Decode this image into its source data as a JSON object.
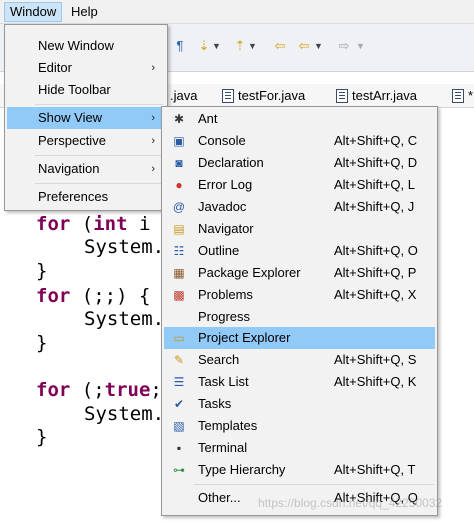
{
  "menubar": {
    "items": [
      {
        "label": "Window"
      },
      {
        "label": "Help"
      }
    ]
  },
  "tabs": [
    {
      "label": ".java"
    },
    {
      "label": "testFor.java"
    },
    {
      "label": "testArr.java"
    },
    {
      "label": "*"
    }
  ],
  "code": {
    "lines": [
      {
        "kw": "for",
        "rest": " (",
        "kw2": "int",
        "rest2": " i"
      },
      {
        "text": "System."
      },
      {
        "text": "}"
      },
      {
        "kw": "for",
        "rest": " (;;) {"
      },
      {
        "text": "System."
      },
      {
        "text": "}"
      },
      {
        "kw": "for",
        "rest": " (;",
        "kw2": "true",
        "rest2": ";"
      },
      {
        "text": "System."
      },
      {
        "text": "}"
      }
    ]
  },
  "window_menu": {
    "items": [
      {
        "label": "New Window"
      },
      {
        "label": "Editor"
      },
      {
        "label": "Hide Toolbar"
      },
      {
        "label": "Show View"
      },
      {
        "label": "Perspective"
      },
      {
        "label": "Navigation"
      },
      {
        "label": "Preferences"
      }
    ],
    "submenu_arrow": "›"
  },
  "show_view": {
    "items": [
      {
        "label": "Ant",
        "shortcut": "",
        "icon": "ant-icon"
      },
      {
        "label": "Console",
        "shortcut": "Alt+Shift+Q, C",
        "icon": "console-icon"
      },
      {
        "label": "Declaration",
        "shortcut": "Alt+Shift+Q, D",
        "icon": "declaration-icon"
      },
      {
        "label": "Error Log",
        "shortcut": "Alt+Shift+Q, L",
        "icon": "error-log-icon"
      },
      {
        "label": "Javadoc",
        "shortcut": "Alt+Shift+Q, J",
        "icon": "javadoc-icon"
      },
      {
        "label": "Navigator",
        "shortcut": "",
        "icon": "navigator-icon"
      },
      {
        "label": "Outline",
        "shortcut": "Alt+Shift+Q, O",
        "icon": "outline-icon"
      },
      {
        "label": "Package Explorer",
        "shortcut": "Alt+Shift+Q, P",
        "icon": "package-explorer-icon"
      },
      {
        "label": "Problems",
        "shortcut": "Alt+Shift+Q, X",
        "icon": "problems-icon"
      },
      {
        "label": "Progress",
        "shortcut": "",
        "icon": "progress-icon"
      },
      {
        "label": "Project Explorer",
        "shortcut": "",
        "icon": "project-explorer-icon"
      },
      {
        "label": "Search",
        "shortcut": "Alt+Shift+Q, S",
        "icon": "search-icon"
      },
      {
        "label": "Task List",
        "shortcut": "Alt+Shift+Q, K",
        "icon": "task-list-icon"
      },
      {
        "label": "Tasks",
        "shortcut": "",
        "icon": "tasks-icon"
      },
      {
        "label": "Templates",
        "shortcut": "",
        "icon": "templates-icon"
      },
      {
        "label": "Terminal",
        "shortcut": "",
        "icon": "terminal-icon"
      },
      {
        "label": "Type Hierarchy",
        "shortcut": "Alt+Shift+Q, T",
        "icon": "type-hierarchy-icon"
      },
      {
        "label": "Other...",
        "shortcut": "Alt+Shift+Q, Q",
        "icon": ""
      }
    ]
  },
  "watermark": "https://blog.csdn.net/qq_42250032",
  "colors": {
    "highlight": "#91c9f7",
    "menubar_active": "#cce4f7",
    "keyword": "#7f0055"
  }
}
